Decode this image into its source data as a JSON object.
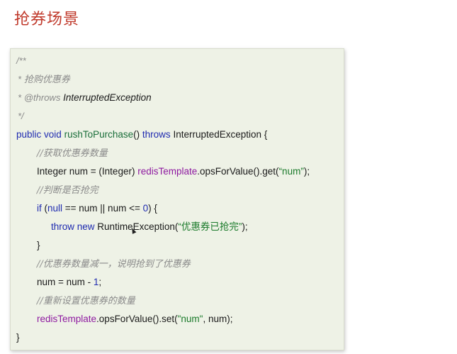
{
  "title": "抢券场景",
  "code": {
    "doc_open": "/**",
    "doc_desc_star": "*",
    "doc_desc": "抢购优惠券",
    "doc_throws_star": "*",
    "doc_throws_tag": "@throws",
    "doc_throws_type": "InterruptedException",
    "doc_close": "*/",
    "sig_public": "public",
    "sig_void": "void",
    "sig_method": "rushToPurchase",
    "sig_parens": "()",
    "sig_throws": "throws",
    "sig_rest": "InterruptedException {",
    "c1": "//获取优惠券数量",
    "l1_a": "Integer num = (Integer) ",
    "l1_field": "redisTemplate",
    "l1_b": ".opsForValue().get(",
    "l1_str": "“num”",
    "l1_c": ");",
    "c2": "//判断是否抢完",
    "l2_if": "if",
    "l2_a": " (",
    "l2_null": "null",
    "l2_b": " == num || num <= ",
    "l2_zero": "0",
    "l2_c": ") {",
    "l3_throw": "throw",
    "l3_new": "new",
    "l3_a": " RuntimeException(",
    "l3_str": "“优惠券已抢完”",
    "l3_b": ");",
    "l4": "}",
    "c3": "//优惠券数量减一，说明抢到了优惠券",
    "l5_a": "num = num - ",
    "l5_one": "1",
    "l5_b": ";",
    "c4": "//重新设置优惠券的数量",
    "l6_field": "redisTemplate",
    "l6_a": ".opsForValue().set(",
    "l6_str": "\"num\"",
    "l6_b": ", num);",
    "l7": "}"
  }
}
